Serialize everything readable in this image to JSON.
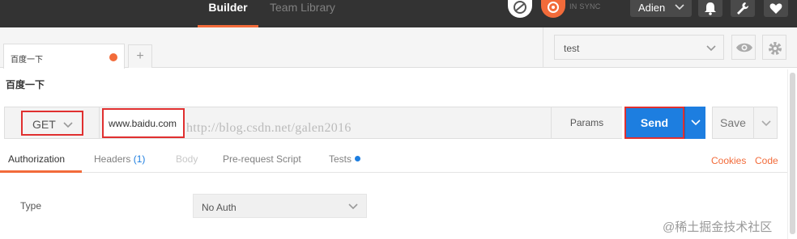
{
  "topbar": {
    "tabs": [
      {
        "label": "Builder",
        "active": true
      },
      {
        "label": "Team Library",
        "active": false
      }
    ],
    "sync_label": "IN SYNC",
    "user": "Adien",
    "icons": [
      "sync-icon",
      "orbit-icon",
      "bell-icon",
      "wrench-icon",
      "heart-icon"
    ]
  },
  "request_tabs": {
    "tab_label": "百度一下",
    "unsaved_dot_color": "#f26b3a",
    "add_label": "+"
  },
  "environment": {
    "selected": "test"
  },
  "request": {
    "title": "百度一下",
    "method": "GET",
    "url": "www.baidu.com",
    "params_label": "Params",
    "send_label": "Send",
    "save_label": "Save"
  },
  "watermark_url": "http://blog.csdn.net/galen2016",
  "subtabs": {
    "authorization": "Authorization",
    "headers": "Headers",
    "headers_count": "(1)",
    "body": "Body",
    "pre_request": "Pre-request Script",
    "tests": "Tests",
    "cookies": "Cookies",
    "code": "Code"
  },
  "auth": {
    "type_label": "Type",
    "type_value": "No Auth"
  },
  "footer_watermark": "@稀土掘金技术社区",
  "colors": {
    "accent": "#f26b3a",
    "primary": "#1d7ee0",
    "highlight": "#e03030",
    "topbar": "#333333"
  }
}
